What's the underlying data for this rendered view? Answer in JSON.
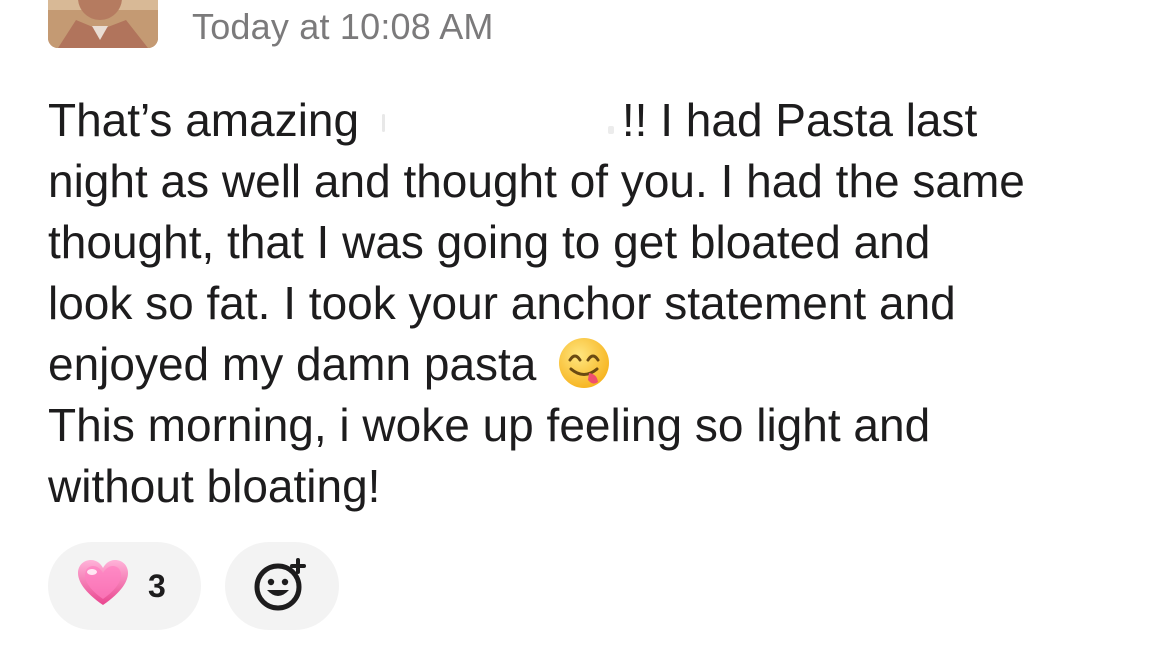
{
  "message": {
    "timestamp": "Today at 10:08 AM",
    "lines": [
      {
        "before": "That’s amazing",
        "after": "!! I had Pasta last"
      },
      "night as well and thought of you. I had the same",
      "thought, that I was going to get bloated and",
      "look so fat. I took your anchor statement and",
      "enjoyed my damn pasta",
      "This morning, i woke up feeling so light and",
      "without bloating!"
    ]
  },
  "reactions": [
    {
      "icon": "sparkling-heart-icon",
      "count": "3"
    }
  ],
  "icons": {
    "inline_emoji": "face-savoring-food-icon",
    "add_reaction": "add-emoji-icon"
  },
  "colors": {
    "text": "#1d1c1d",
    "timestamp": "#7b7a7b",
    "pill_bg": "#f3f3f3",
    "heart": "#f06fb0"
  }
}
